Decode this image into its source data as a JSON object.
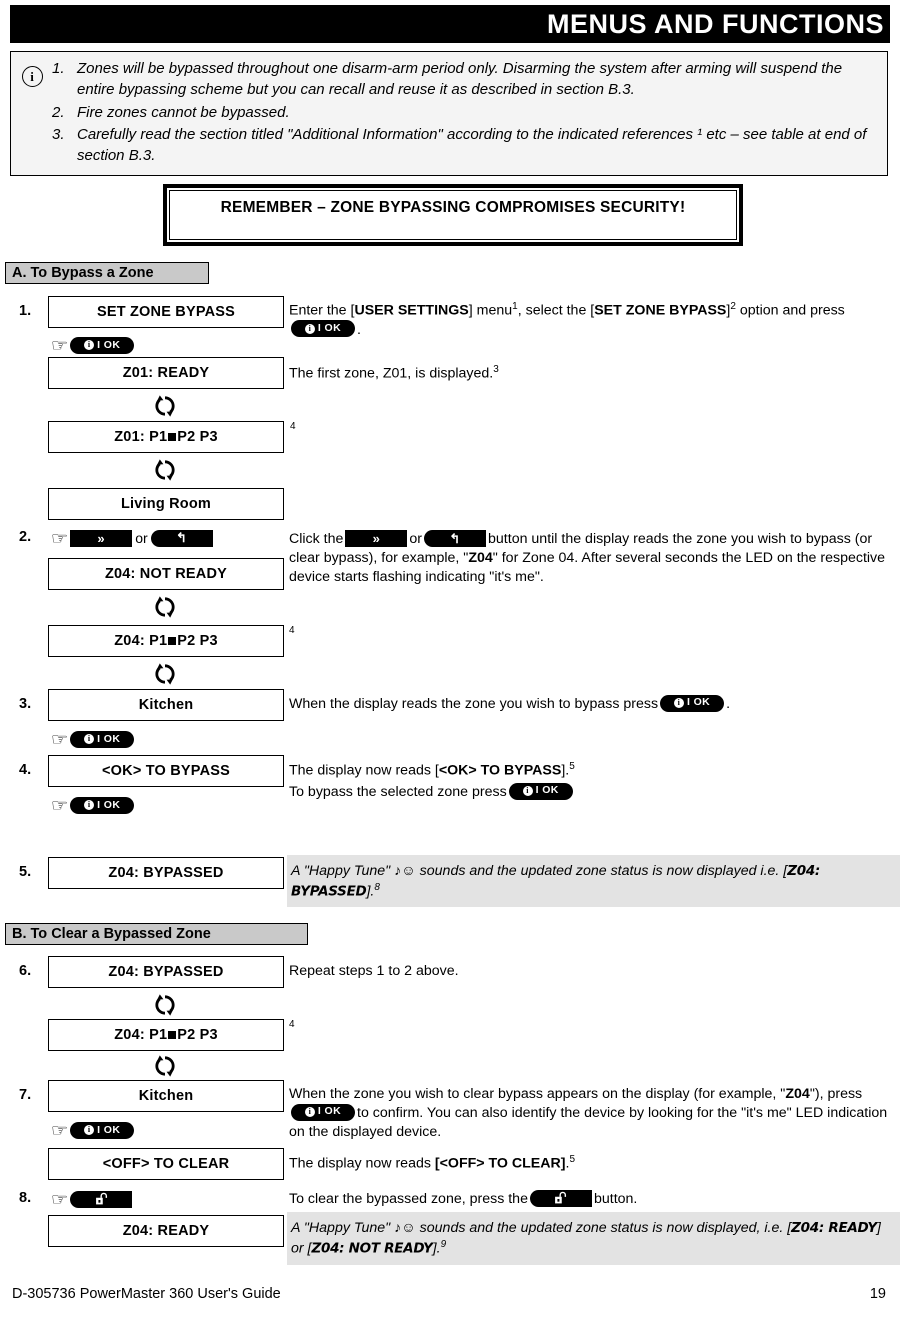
{
  "header": {
    "title": "MENUS AND FUNCTIONS"
  },
  "note": {
    "icon": "info-circle-icon",
    "items": [
      "Zones will be bypassed throughout one disarm-arm period only. Disarming the system after arming will suspend the entire bypassing scheme but you can recall and reuse it as described in section B.3.",
      "Fire zones cannot be bypassed.",
      "Carefully read the section titled \"Additional Information\" according to the indicated references ¹ etc – see table at end of section B.3."
    ],
    "numbers": [
      "1.",
      "2.",
      "3."
    ]
  },
  "remember": {
    "text": "REMEMBER – ZONE BYPASSING COMPROMISES SECURITY!"
  },
  "sections": {
    "a": {
      "label": "A. To Bypass a Zone"
    },
    "b": {
      "label": "B. To Clear a Bypassed Zone"
    }
  },
  "keys": {
    "ok_label": "I OK",
    "ok_i": "i",
    "ff_label": "»",
    "back_label": "↰",
    "hand": "☞",
    "unlock_name": "unlock-padlock-icon"
  },
  "steps": {
    "s1": {
      "num": "1.",
      "lcd1": "SET ZONE BYPASS",
      "lcd2": "Z01: READY",
      "lcd3_prefix": "Z01: P1",
      "lcd3_suffix": "P2   P3",
      "lcd4": "Living Room",
      "text1_a": "Enter the [",
      "text1_b": "USER SETTINGS",
      "text1_c": "] menu",
      "text1_sup1": "1",
      "text1_d": ", select the [",
      "text1_e": "SET ZONE BYPASS",
      "text1_f": "]",
      "text1_sup2": "2",
      "text1_g": "option and press",
      "text1_h": ".",
      "text2": "The first zone, Z01, is displayed.",
      "text2_sup": "3",
      "sup4": "4"
    },
    "s2": {
      "num": "2.",
      "or_label": "or",
      "lcd1": "Z04: NOT READY",
      "lcd2_prefix": "Z04: P1",
      "lcd2_suffix": "P2   P3",
      "text_a": "Click the",
      "text_b": "or",
      "text_c": "button until the display reads the zone you wish to bypass (or clear bypass), for example, \"",
      "text_d": "Z04",
      "text_e": "\" for Zone 04. After several seconds the LED on the respective device starts flashing indicating \"it's me\".",
      "sup4": "4"
    },
    "s3": {
      "num": "3.",
      "lcd1": "Kitchen",
      "text_a": "When the display reads the zone you wish to bypass press",
      "text_b": "."
    },
    "s4": {
      "num": "4.",
      "lcd1": "<OK> TO BYPASS",
      "text_a": "The display now reads [",
      "text_b": "<OK> TO BYPASS",
      "text_c": "].",
      "sup": "5",
      "text_d": "To bypass the selected zone press"
    },
    "s5": {
      "num": "5.",
      "lcd1": "Z04: BYPASSED",
      "text_a": "A \"Happy Tune\" ",
      "text_note": "♪☺",
      "text_b": " sounds and the updated zone status is now displayed i.e. [",
      "text_c": "Z04: BYPASSED",
      "text_d": "].",
      "sup": "8"
    },
    "s6": {
      "num": "6.",
      "lcd1": "Z04: BYPASSED",
      "lcd2_prefix": "Z04: P1",
      "lcd2_suffix": "P2   P3",
      "text_a": "Repeat steps 1 to 2 above.",
      "sup4": "4"
    },
    "s7": {
      "num": "7.",
      "lcd1": "Kitchen",
      "lcd2": "<OFF> TO CLEAR",
      "text_a": "When the zone you wish to clear bypass appears on the display (for example, \"",
      "text_b": "Z04",
      "text_c": "\"), press",
      "text_d": "to confirm. You can also identify the device by looking for the \"it's me\" LED indication on the displayed device.",
      "text_e": "The display now reads ",
      "text_f": "[<OFF> TO CLEAR]",
      "text_g": ".",
      "sup": "5"
    },
    "s8": {
      "num": "8.",
      "lcd1": "Z04: READY",
      "text_a": "To clear the bypassed zone, press the",
      "text_b": "button.",
      "text_c": "A \"Happy Tune\" ",
      "text_note": "♪☺",
      "text_d": " sounds and the updated zone status is now displayed, i.e. [",
      "text_e": "Z04: READY",
      "text_f": "] or [",
      "text_g": "Z04: NOT READY",
      "text_h": "].",
      "sup": "9"
    }
  },
  "footer": {
    "left": "D-305736 PowerMaster 360 User's Guide",
    "right": "19"
  }
}
